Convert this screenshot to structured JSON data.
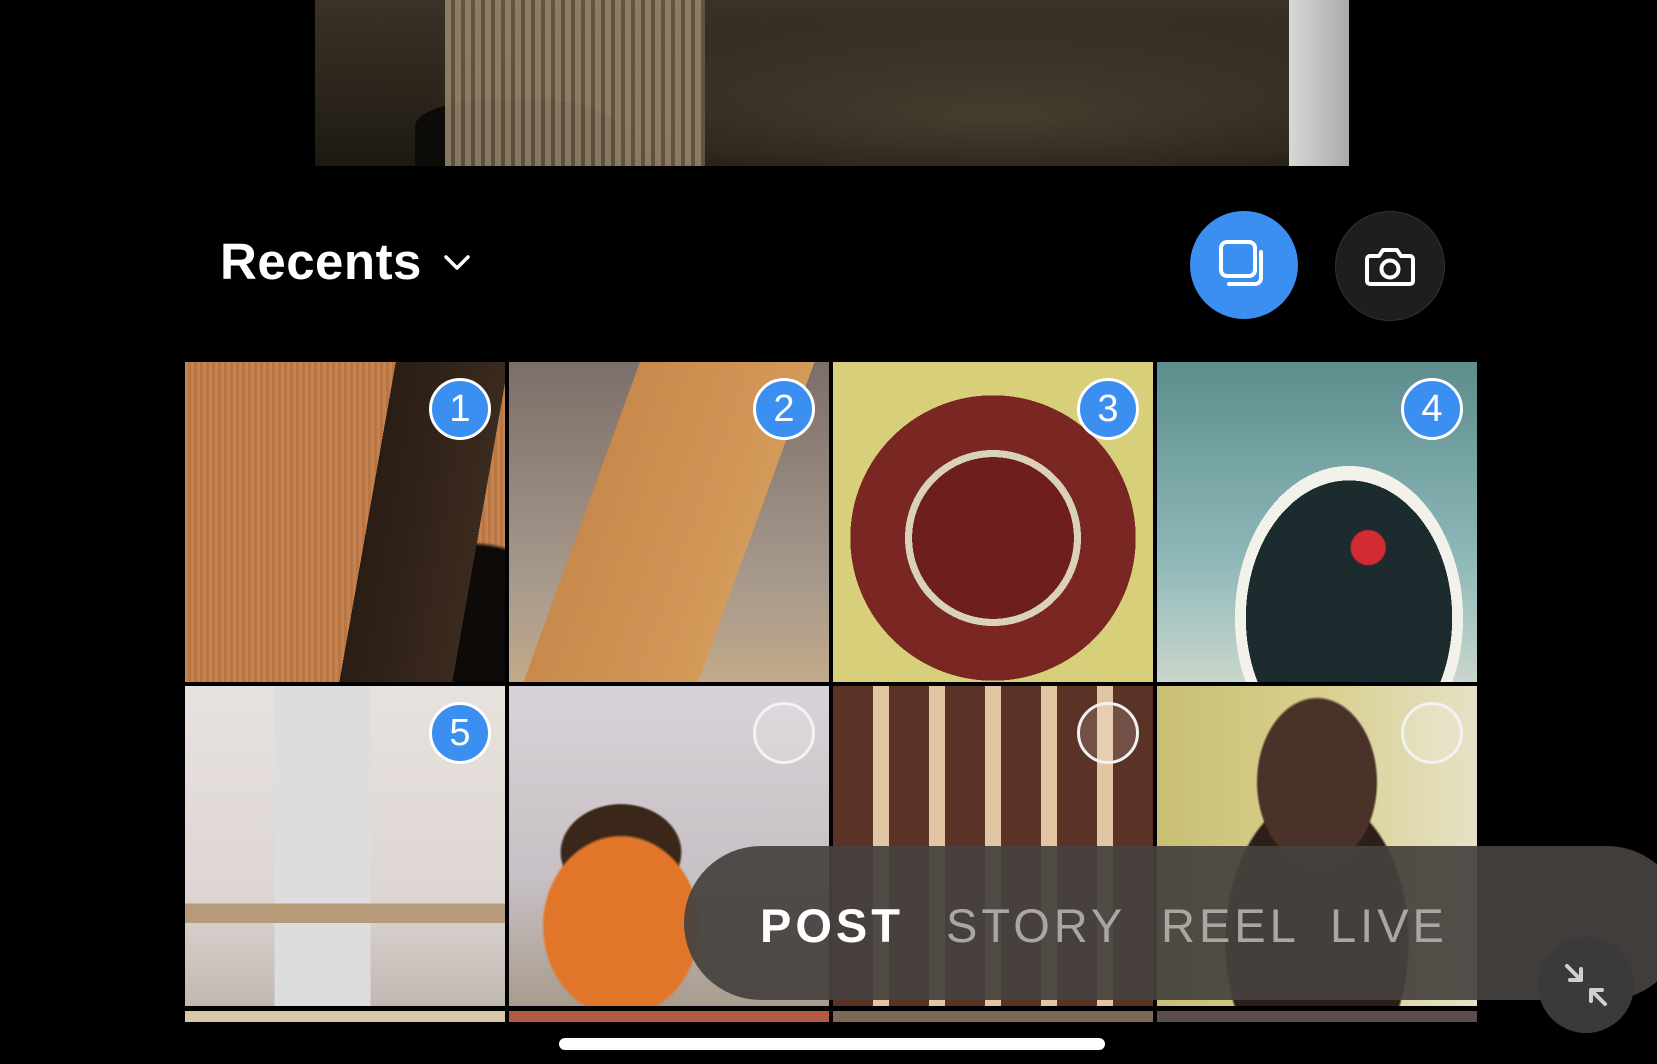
{
  "album": {
    "label": "Recents"
  },
  "buttons": {
    "multi_select": "select-multiple",
    "camera": "camera"
  },
  "colors": {
    "accent": "#3b8ff0",
    "background": "#000000"
  },
  "grid": {
    "tiles": [
      {
        "subject": "acoustic guitar",
        "badge": "1",
        "selected": true
      },
      {
        "subject": "bass guitar headstock",
        "badge": "2",
        "selected": true
      },
      {
        "subject": "wall clock",
        "badge": "3",
        "selected": true
      },
      {
        "subject": "cake with strawberry",
        "badge": "4",
        "selected": true
      },
      {
        "subject": "side table with decor",
        "badge": "5",
        "selected": true
      },
      {
        "subject": "dog in orange sweater",
        "badge": "",
        "selected": false
      },
      {
        "subject": "building arches",
        "badge": "",
        "selected": false
      },
      {
        "subject": "person with long hair",
        "badge": "",
        "selected": false
      }
    ]
  },
  "modes": {
    "post": "POST",
    "story": "STORY",
    "reel": "REEL",
    "live": "LIVE",
    "active": "POST"
  }
}
